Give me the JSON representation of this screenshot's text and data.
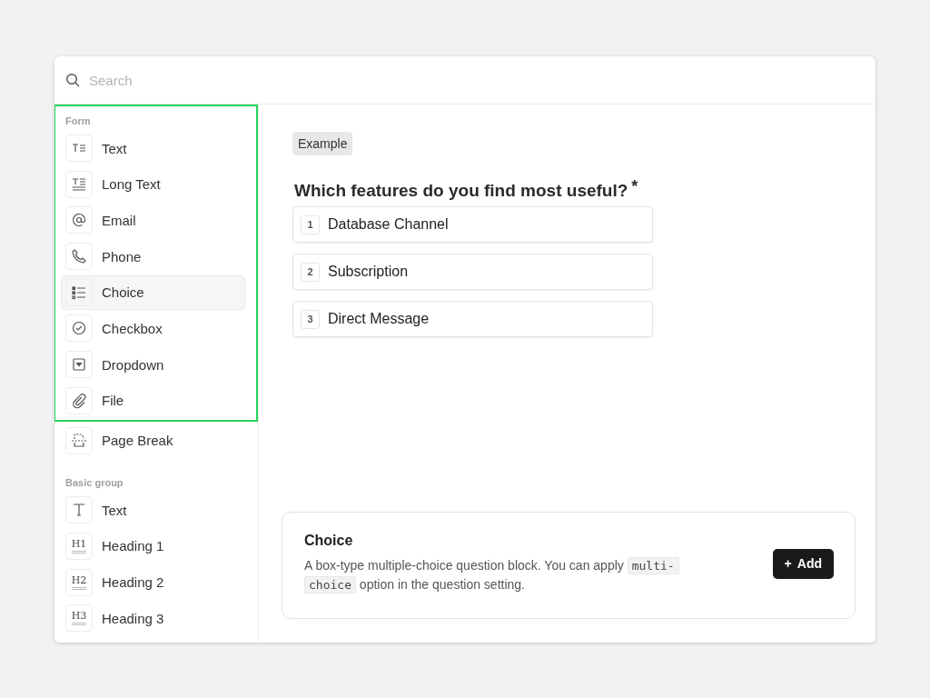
{
  "search": {
    "placeholder": "Search"
  },
  "sidebar": {
    "groups": [
      {
        "title": "Form",
        "highlighted": true,
        "items": [
          {
            "label": "Text",
            "selected": false
          },
          {
            "label": "Long Text",
            "selected": false
          },
          {
            "label": "Email",
            "selected": false
          },
          {
            "label": "Phone",
            "selected": false
          },
          {
            "label": "Choice",
            "selected": true
          },
          {
            "label": "Checkbox",
            "selected": false
          },
          {
            "label": "Dropdown",
            "selected": false
          },
          {
            "label": "File",
            "selected": false
          }
        ]
      },
      {
        "highlighted": false,
        "items": [
          {
            "label": "Page Break",
            "selected": false
          }
        ]
      },
      {
        "title": "Basic group",
        "highlighted": false,
        "items": [
          {
            "label": "Text",
            "selected": false
          },
          {
            "label": "Heading 1",
            "icon_text": "H1",
            "selected": false
          },
          {
            "label": "Heading 2",
            "icon_text": "H2",
            "selected": false
          },
          {
            "label": "Heading 3",
            "icon_text": "H3",
            "selected": false
          }
        ]
      }
    ]
  },
  "preview": {
    "badge": "Example",
    "question": "Which features do you find most useful?",
    "required_mark": "*",
    "options": [
      {
        "number": "1",
        "label": "Database Channel"
      },
      {
        "number": "2",
        "label": "Subscription"
      },
      {
        "number": "3",
        "label": "Direct Message"
      }
    ]
  },
  "info_card": {
    "title": "Choice",
    "description": [
      {
        "kind": "text",
        "text": "A box-type multiple-choice question block. You can apply "
      },
      {
        "kind": "code",
        "text": "multi-choice"
      },
      {
        "kind": "text",
        "text": " option in the question setting."
      }
    ],
    "button": {
      "icon": "+",
      "label": "Add"
    }
  }
}
